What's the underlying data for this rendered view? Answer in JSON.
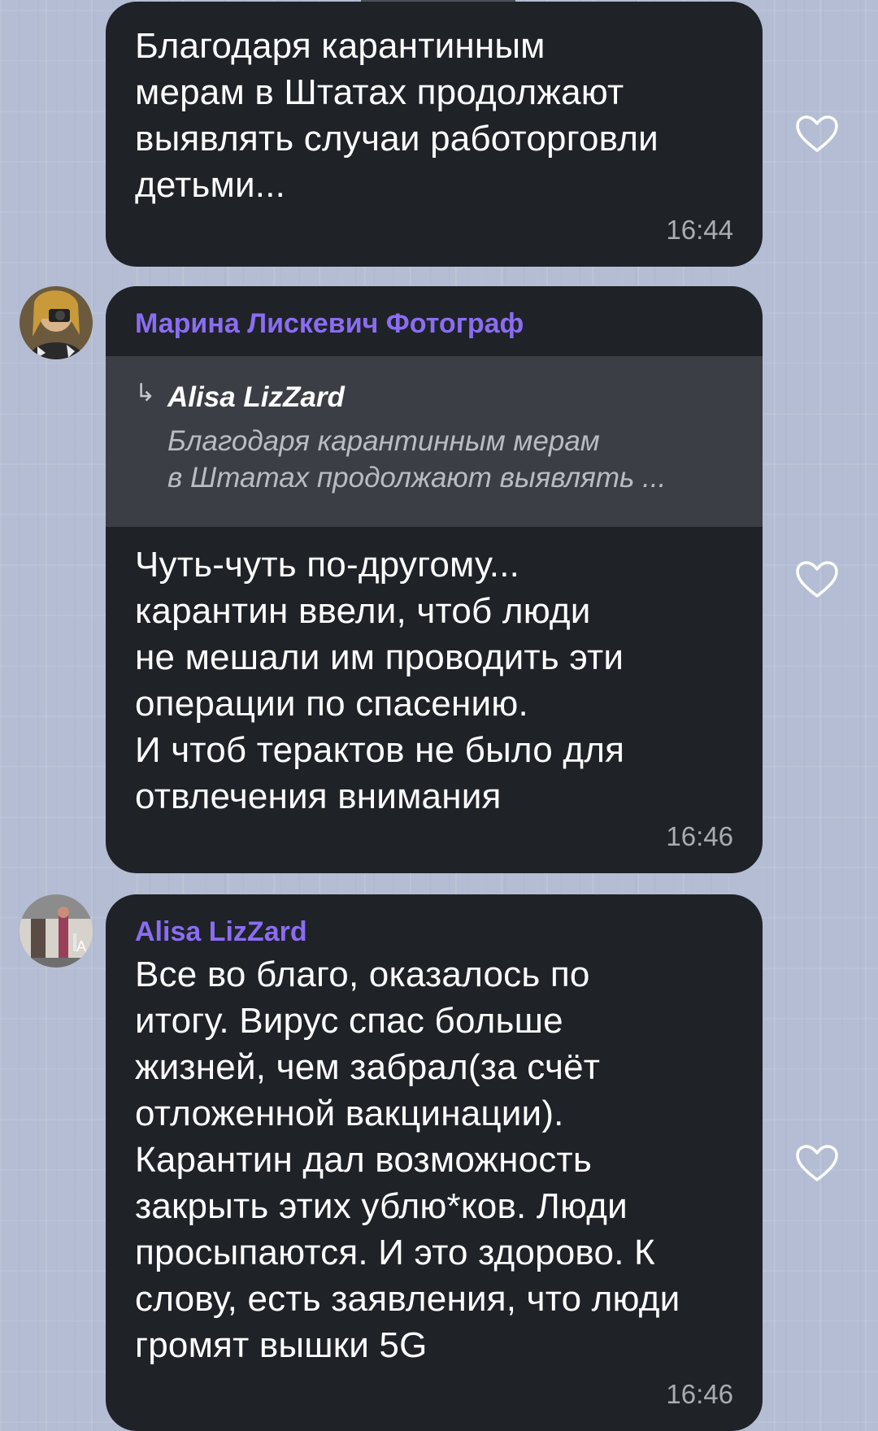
{
  "messages": [
    {
      "text": "Благодаря карантинным\nмерам в Штатах продолжают\nвыявлять случаи работорговли\nдетьми...",
      "time": "16:44"
    },
    {
      "sender": "Марина Лискевич Фотограф",
      "reply": {
        "author": "Alisa LizZard",
        "text": "Благодаря карантинным мерам\nв Штатах продолжают выявлять ..."
      },
      "text": "Чуть-чуть по-другому...\nкарантин ввели, чтоб люди\nне мешали им проводить эти\nоперации по спасению.\nИ чтоб терактов не было для\nотвлечения внимания",
      "time": "16:46"
    },
    {
      "sender": "Alisa LizZard",
      "text": "Все во благо, оказалось по\nитогу. Вирус спас больше\nжизней, чем забрал(за счёт\nотложенной вакцинации).\nКарантин дал возможность\nзакрыть этих ублю*ков. Люди\nпросыпаются. И это здорово. К\nслову, есть заявления, что люди\nгромят вышки 5G",
      "time": "16:46"
    }
  ],
  "reply_arrow": "↳",
  "colors": {
    "bubble": "#1f2227",
    "sender": "#8a6df2",
    "reply_bg": "#3b3e44",
    "background": "#b4bdd3"
  },
  "icons": [
    "heart-outline-icon",
    "reply-arrow-icon",
    "avatar"
  ]
}
